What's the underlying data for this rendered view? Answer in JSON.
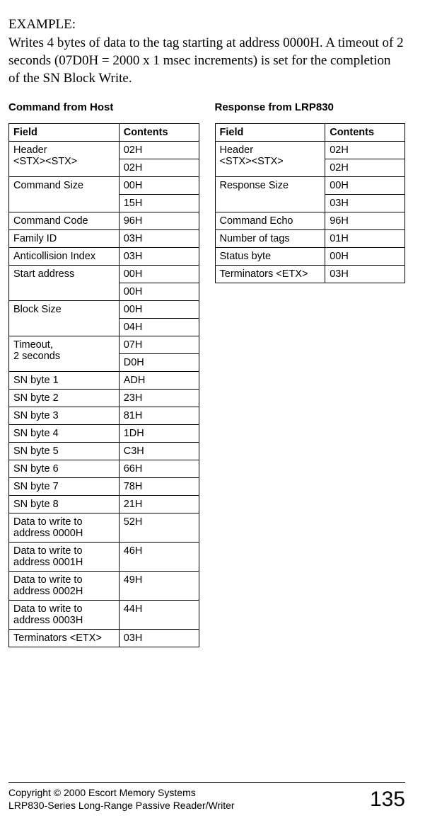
{
  "example": {
    "label": "EXAMPLE:",
    "text": "Writes 4 bytes of data to the tag starting at address 0000H. A timeout of 2 seconds (07D0H = 2000 x 1 msec increments) is set for the completion of the SN Block Write."
  },
  "left": {
    "title": "Command from Host",
    "headers": {
      "field": "Field",
      "contents": "Contents"
    },
    "rows": [
      {
        "field": "Header\n<STX><STX>",
        "contents": "02H",
        "rowspan": 2
      },
      {
        "contents": "02H"
      },
      {
        "field": "Command Size",
        "contents": "00H",
        "rowspan": 2
      },
      {
        "contents": "15H"
      },
      {
        "field": "Command Code",
        "contents": "96H"
      },
      {
        "field": "Family ID",
        "contents": "03H"
      },
      {
        "field": "Anticollision Index",
        "contents": "03H"
      },
      {
        "field": "Start address",
        "contents": "00H",
        "rowspan": 2
      },
      {
        "contents": "00H"
      },
      {
        "field": "Block Size",
        "contents": "00H",
        "rowspan": 2
      },
      {
        "contents": "04H"
      },
      {
        "field": "Timeout,\n2 seconds",
        "contents": "07H",
        "rowspan": 2
      },
      {
        "contents": "D0H"
      },
      {
        "field": "SN byte 1",
        "contents": "ADH"
      },
      {
        "field": "SN byte 2",
        "contents": "23H"
      },
      {
        "field": "SN byte 3",
        "contents": "81H"
      },
      {
        "field": "SN byte 4",
        "contents": "1DH"
      },
      {
        "field": "SN byte 5",
        "contents": "C3H"
      },
      {
        "field": "SN byte 6",
        "contents": "66H"
      },
      {
        "field": "SN byte 7",
        "contents": "78H"
      },
      {
        "field": "SN byte 8",
        "contents": "21H"
      },
      {
        "field": "Data to write to address 0000H",
        "contents": "52H"
      },
      {
        "field": "Data to write to address 0001H",
        "contents": "46H"
      },
      {
        "field": "Data to write to address 0002H",
        "contents": "49H"
      },
      {
        "field": "Data to write to address 0003H",
        "contents": "44H"
      },
      {
        "field": "Terminators <ETX>",
        "contents": "03H"
      }
    ]
  },
  "right": {
    "title": "Response from LRP830",
    "headers": {
      "field": "Field",
      "contents": "Contents"
    },
    "rows": [
      {
        "field": "Header\n<STX><STX>",
        "contents": "02H",
        "rowspan": 2
      },
      {
        "contents": "02H"
      },
      {
        "field": "Response Size",
        "contents": "00H",
        "rowspan": 2
      },
      {
        "contents": "03H"
      },
      {
        "field": "Command Echo",
        "contents": "96H"
      },
      {
        "field": "Number of tags",
        "contents": "01H"
      },
      {
        "field": "Status byte",
        "contents": "00H"
      },
      {
        "field": "Terminators <ETX>",
        "contents": "03H"
      }
    ]
  },
  "footer": {
    "line1": "Copyright © 2000 Escort Memory Systems",
    "line2": "LRP830-Series Long-Range Passive Reader/Writer",
    "page": "135"
  }
}
